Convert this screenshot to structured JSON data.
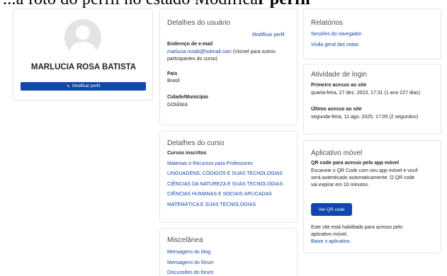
{
  "top_banner": {
    "text_normal": "...a foto do perfil no estado Modifica",
    "text_bold": "r perfil",
    "trailing": ""
  },
  "profile": {
    "full_name": "MARLUCIA ROSA BATISTA",
    "edit_button_label": "Modificar perfil"
  },
  "user_details": {
    "title": "Detalhes do usuário",
    "edit_link": "Modificar perfil",
    "email_label": "Endereço de e-mail",
    "email_value": "marlucia.rosab@hotmail.com",
    "email_visibility": " (Visível para outros",
    "email_visibility_2": "participantes do curso)",
    "country_label": "País",
    "country_value": "Brasil",
    "city_label": "Cidade/Município",
    "city_value": "GOIÂNIA"
  },
  "course_details": {
    "title": "Detalhes do curso",
    "enrolled_label": "Cursos inscritos",
    "courses": [
      "Materiais e Recursos para Professores",
      "LINGUAGENS, CÓDIGOS E SUAS TECNOLOGIAS",
      "CIÊNCIAS DA NATUREZA E SUAS TECNOLOGIAS",
      "CIÊNCIAS HUMANAS E SOCIAIS APLICADAS",
      "MATEMÁTICA E SUAS TECNOLOGIAS"
    ]
  },
  "misc": {
    "title": "Miscelânea",
    "links": [
      "Mensagens do blog",
      "Mensagens do fórum",
      "Discussões do fórum"
    ]
  },
  "reports": {
    "title": "Relatórios",
    "links": [
      "Sessões do navegador",
      "Visão geral das notas"
    ]
  },
  "login_activity": {
    "title": "Atividade de login",
    "first_access_label": "Primeiro acesso ao site",
    "first_access_value": "quarta-feira, 27 dez. 2023, 17:31  (1 ano 227 dias)",
    "last_access_label": "Último acesso ao site",
    "last_access_value": "segunda-feira, 11 ago. 2025, 17:05  (2 segundos)"
  },
  "mobile_app": {
    "title": "Aplicativo móvel",
    "qr_label": "QR code para acesso pelo app móvel",
    "qr_desc_1": "Escaneie o QR Code com seu app móvel e você",
    "qr_desc_2": "será autenticado automaticamente. O QR code",
    "qr_desc_3": "vai expirar em 10 minutos.",
    "qr_button": "Ver QR code",
    "enabled_1": "Este site está habilitado para acesso pelo",
    "enabled_2": "aplicativo móvel.",
    "download_link": "Baixe o aplicativo."
  },
  "colors": {
    "link": "#0f47ad",
    "button_bg": "#0f47ad",
    "card_border": "#e3e5e8",
    "avatar_bg": "#e3e4e6"
  },
  "icons": {
    "avatar": "user-silhouette-icon",
    "edit": "pencil-square-icon"
  }
}
